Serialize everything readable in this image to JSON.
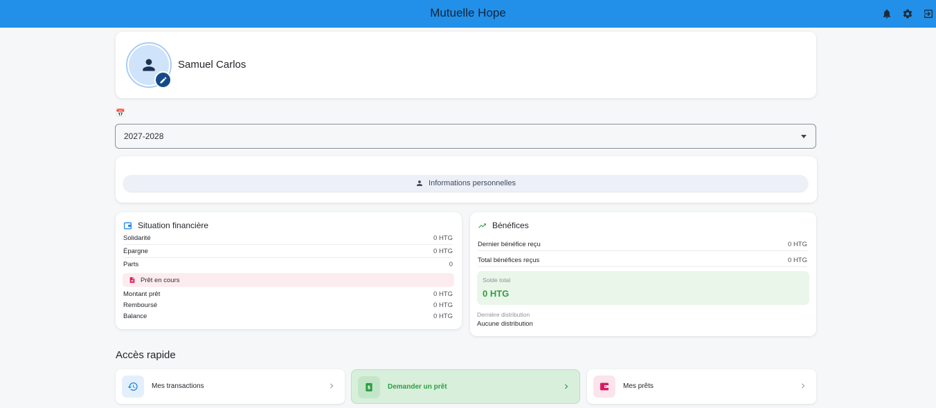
{
  "header": {
    "title": "Mutuelle Hope",
    "icons": [
      "bell-icon",
      "gear-icon",
      "logout-icon"
    ]
  },
  "profile": {
    "name": "Samuel Carlos"
  },
  "year_select": {
    "value": "2027-2028"
  },
  "personal_info": {
    "label": "Informations personnelles"
  },
  "financial": {
    "title": "Situation financière",
    "rows": [
      {
        "label": "Solidarité",
        "value": "0 HTG"
      },
      {
        "label": "Épargne",
        "value": "0 HTG"
      },
      {
        "label": "Parts",
        "value": "0"
      }
    ],
    "loan_label": "Prêt en cours",
    "loan_rows": [
      {
        "label": "Montant prêt",
        "value": "0 HTG"
      },
      {
        "label": "Remboursé",
        "value": "0 HTG"
      },
      {
        "label": "Balance",
        "value": "0 HTG"
      }
    ]
  },
  "benefits": {
    "title": "Bénéfices",
    "rows": [
      {
        "label": "Dernier bénéfice reçu",
        "value": "0 HTG"
      },
      {
        "label": "Total bénéfices reçus",
        "value": "0 HTG"
      }
    ],
    "solde_label": "Solde total",
    "solde_value": "0 HTG",
    "distribution_label": "Dernière distribution",
    "distribution_value": "Aucune distribution"
  },
  "quick_access": {
    "title": "Accès rapide",
    "items": [
      {
        "label": "Mes transactions",
        "icon": "history-icon"
      },
      {
        "label": "Demander un prêt",
        "icon": "dollar-icon"
      },
      {
        "label": "Mes prêts",
        "icon": "wallet-icon"
      }
    ]
  },
  "colors": {
    "header": "#2290e8",
    "accent_green": "#2e9e41",
    "accent_pink": "#d81b60",
    "accent_blue": "#1e88e5"
  }
}
